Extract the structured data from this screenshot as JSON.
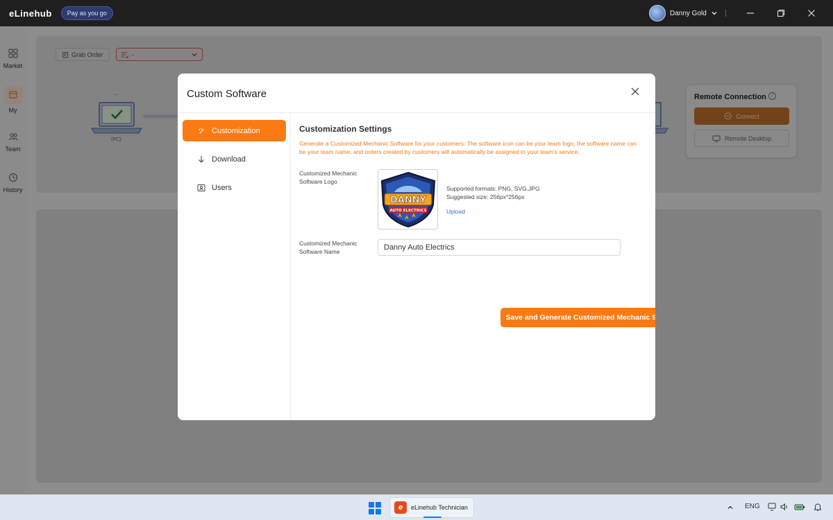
{
  "titlebar": {
    "app_name": "eLinehub",
    "plan_badge": "Pay as you go",
    "user_name": "Danny Gold"
  },
  "leftnav": {
    "items": [
      {
        "label": "Market",
        "icon": "grid-icon"
      },
      {
        "label": "My",
        "icon": "box-icon",
        "active": true
      },
      {
        "label": "Team",
        "icon": "team-icon"
      },
      {
        "label": "History",
        "icon": "history-icon"
      }
    ]
  },
  "toolbar": {
    "grab_order_label": "Grab Order",
    "order_select_value": "-"
  },
  "device": {
    "dash": "-",
    "pc_label": "(PC)"
  },
  "remote": {
    "title": "Remote Connection",
    "connect_label": "Connect",
    "remote_desktop_label": "Remote Desktop"
  },
  "modal": {
    "title": "Custom Software",
    "sidebar": [
      {
        "label": "Customization",
        "active": true
      },
      {
        "label": "Download"
      },
      {
        "label": "Users"
      }
    ],
    "section_title": "Customization Settings",
    "section_desc": "Generate a Customized Mechanic Software for your customers: The software icon can be your team logo, the software name can be your team name, and orders created by customers will automatically be assigned to your team's service.",
    "logo_label": "Customized Mechanic Software Logo",
    "logo_text_top": "DANNY",
    "logo_text_bottom": "AUTO ELECTRICS",
    "formats": "Supported formats: PNG, SVG,JPG",
    "size": "Suggested size: 256px*256px",
    "upload_label": "Upload",
    "name_label": "Customized Mechanic Software Name",
    "name_value": "Danny Auto Electrics",
    "save_label": "Save and Generate Customized Mechanic Software"
  },
  "taskbar": {
    "app_label": "eLinehub Technician",
    "language": "ENG"
  },
  "colors": {
    "accent": "#fb7a14",
    "link": "#2f6bd6",
    "titlebar": "#1f1f1f"
  }
}
